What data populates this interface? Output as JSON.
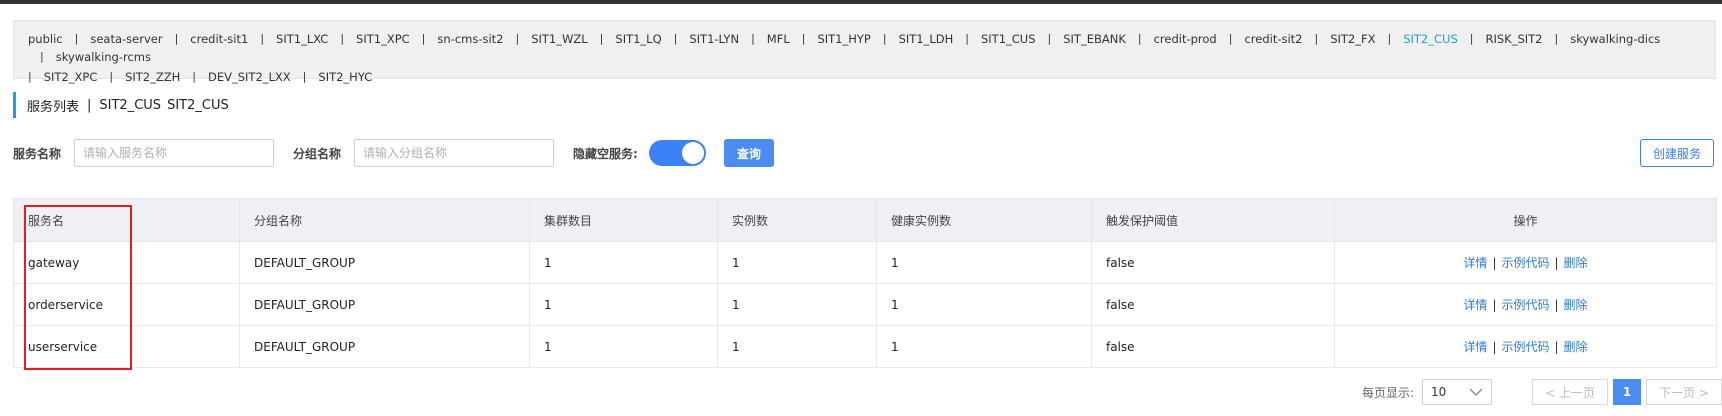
{
  "namespaces": {
    "items": [
      {
        "label": "public",
        "active": false
      },
      {
        "label": "seata-server",
        "active": false
      },
      {
        "label": "credit-sit1",
        "active": false
      },
      {
        "label": "SIT1_LXC",
        "active": false
      },
      {
        "label": "SIT1_XPC",
        "active": false
      },
      {
        "label": "sn-cms-sit2",
        "active": false
      },
      {
        "label": "SIT1_WZL",
        "active": false
      },
      {
        "label": "SIT1_LQ",
        "active": false
      },
      {
        "label": "SIT1-LYN",
        "active": false
      },
      {
        "label": "MFL",
        "active": false
      },
      {
        "label": "SIT1_HYP",
        "active": false
      },
      {
        "label": "SIT1_LDH",
        "active": false
      },
      {
        "label": "SIT1_CUS",
        "active": false
      },
      {
        "label": "SIT_EBANK",
        "active": false
      },
      {
        "label": "credit-prod",
        "active": false
      },
      {
        "label": "credit-sit2",
        "active": false
      },
      {
        "label": "SIT2_FX",
        "active": false
      },
      {
        "label": "SIT2_CUS",
        "active": true
      },
      {
        "label": "RISK_SIT2",
        "active": false
      },
      {
        "label": "skywalking-dics",
        "active": false
      },
      {
        "label": "skywalking-rcms",
        "active": false
      },
      {
        "label": "SIT2_XPC",
        "active": false
      },
      {
        "label": "SIT2_ZZH",
        "active": false
      },
      {
        "label": "DEV_SIT2_LXX",
        "active": false
      },
      {
        "label": "SIT2_HYC",
        "active": false
      }
    ],
    "separator": "|",
    "active_color": "#1aa3d9"
  },
  "header": {
    "title": "服务列表",
    "separator": "|",
    "namespace_name": "SIT2_CUS",
    "namespace_id": "SIT2_CUS"
  },
  "filters": {
    "service_name_label": "服务名称",
    "service_name_placeholder": "请输入服务名称",
    "group_name_label": "分组名称",
    "group_name_placeholder": "请输入分组名称",
    "hide_empty_label": "隐藏空服务:",
    "hide_empty_on": true,
    "query_label": "查询",
    "create_label": "创建服务"
  },
  "table": {
    "columns": [
      "服务名",
      "分组名称",
      "集群数目",
      "实例数",
      "健康实例数",
      "触发保护阈值",
      "操作"
    ],
    "rows": [
      {
        "name": "gateway",
        "group": "DEFAULT_GROUP",
        "clusters": "1",
        "instances": "1",
        "healthy": "1",
        "threshold": "false"
      },
      {
        "name": "orderservice",
        "group": "DEFAULT_GROUP",
        "clusters": "1",
        "instances": "1",
        "healthy": "1",
        "threshold": "false"
      },
      {
        "name": "userservice",
        "group": "DEFAULT_GROUP",
        "clusters": "1",
        "instances": "1",
        "healthy": "1",
        "threshold": "false"
      }
    ],
    "ops": {
      "detail": "详情",
      "sample_code": "示例代码",
      "delete": "删除",
      "separator": "|"
    }
  },
  "pagination": {
    "page_size_label": "每页显示:",
    "page_size": "10",
    "prev_label": "< 上一页",
    "current_page": "1",
    "next_label": "下一页 >"
  },
  "colors": {
    "accent": "#4a8cf0",
    "highlight_box": "#e02020",
    "link": "#2d7bd8"
  }
}
